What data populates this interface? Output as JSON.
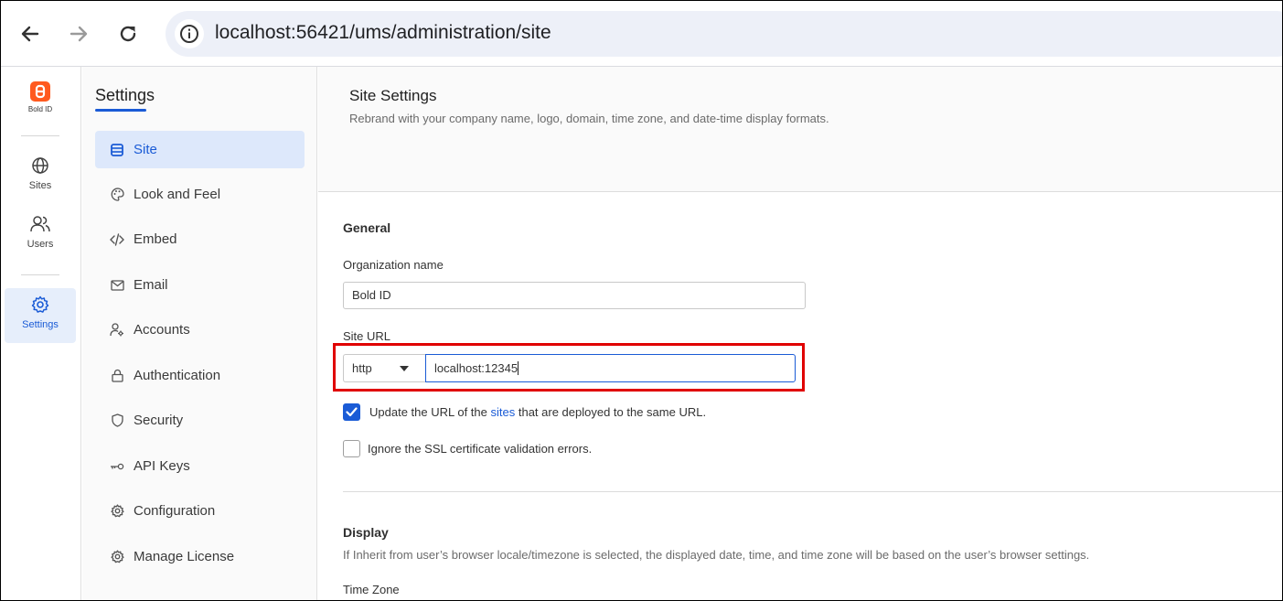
{
  "browser": {
    "url": "localhost:56421/ums/administration/site"
  },
  "rail": {
    "logo_text": "Bold ID",
    "items": [
      {
        "label": "Sites",
        "icon": "globe-icon"
      },
      {
        "label": "Users",
        "icon": "users-icon"
      },
      {
        "label": "Settings",
        "icon": "gear-icon",
        "active": true
      }
    ]
  },
  "sidebar": {
    "title": "Settings",
    "items": [
      {
        "label": "Site",
        "icon": "site-icon",
        "active": true
      },
      {
        "label": "Look and Feel",
        "icon": "palette-icon"
      },
      {
        "label": "Embed",
        "icon": "code-icon"
      },
      {
        "label": "Email",
        "icon": "mail-icon"
      },
      {
        "label": "Accounts",
        "icon": "accounts-icon"
      },
      {
        "label": "Authentication",
        "icon": "lock-icon"
      },
      {
        "label": "Security",
        "icon": "shield-icon"
      },
      {
        "label": "API Keys",
        "icon": "key-icon"
      },
      {
        "label": "Configuration",
        "icon": "gear-icon"
      },
      {
        "label": "Manage License",
        "icon": "gear-icon"
      }
    ]
  },
  "main": {
    "title": "Site Settings",
    "subtitle": "Rebrand with your company name, logo, domain, time zone, and date-time display formats.",
    "general": {
      "title": "General",
      "org_label": "Organization name",
      "org_value": "Bold ID",
      "site_url_label": "Site URL",
      "protocol": "http",
      "site_url_value": "localhost:12345",
      "update_url_prefix": "Update the URL of the ",
      "update_url_link": "sites",
      "update_url_suffix": " that are deployed to the same URL.",
      "update_url_checked": true,
      "ignore_ssl_label": "Ignore the SSL certificate validation errors.",
      "ignore_ssl_checked": false
    },
    "display": {
      "title": "Display",
      "description": "If Inherit from user’s browser locale/timezone is selected, the displayed date, time, and time zone will be based on the user’s browser settings.",
      "time_zone_label": "Time Zone"
    }
  },
  "colors": {
    "accent": "#1a5bd6",
    "brand": "#ff5a1f",
    "highlight": "#e00000"
  }
}
